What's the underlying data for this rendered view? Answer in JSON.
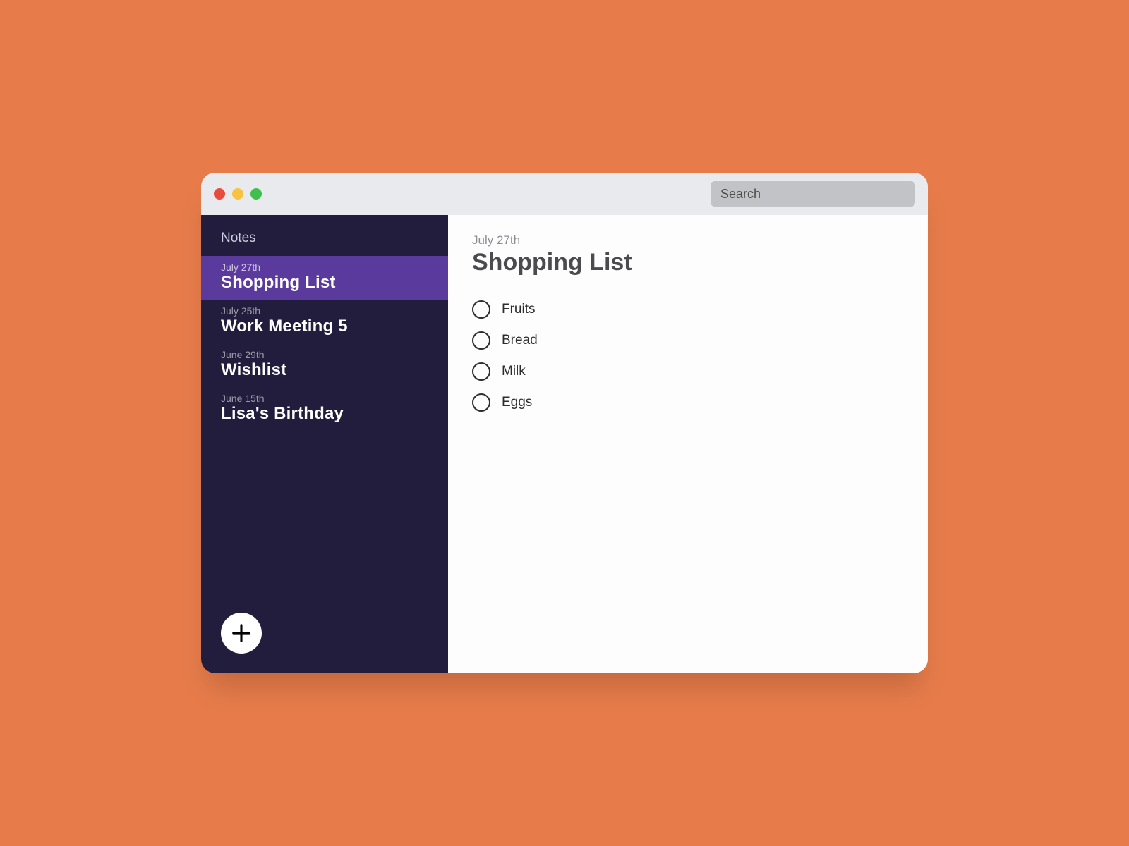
{
  "search_placeholder": "Search",
  "sidebar": {
    "title": "Notes",
    "notes": [
      {
        "date": "July 27th",
        "title": "Shopping List",
        "selected": true
      },
      {
        "date": "July 25th",
        "title": "Work Meeting 5",
        "selected": false
      },
      {
        "date": "June 29th",
        "title": "Wishlist",
        "selected": false
      },
      {
        "date": "June 15th",
        "title": "Lisa's Birthday",
        "selected": false
      }
    ]
  },
  "note": {
    "date": "July 27th",
    "title": "Shopping List",
    "items": [
      "Fruits",
      "Bread",
      "Milk",
      "Eggs"
    ]
  }
}
